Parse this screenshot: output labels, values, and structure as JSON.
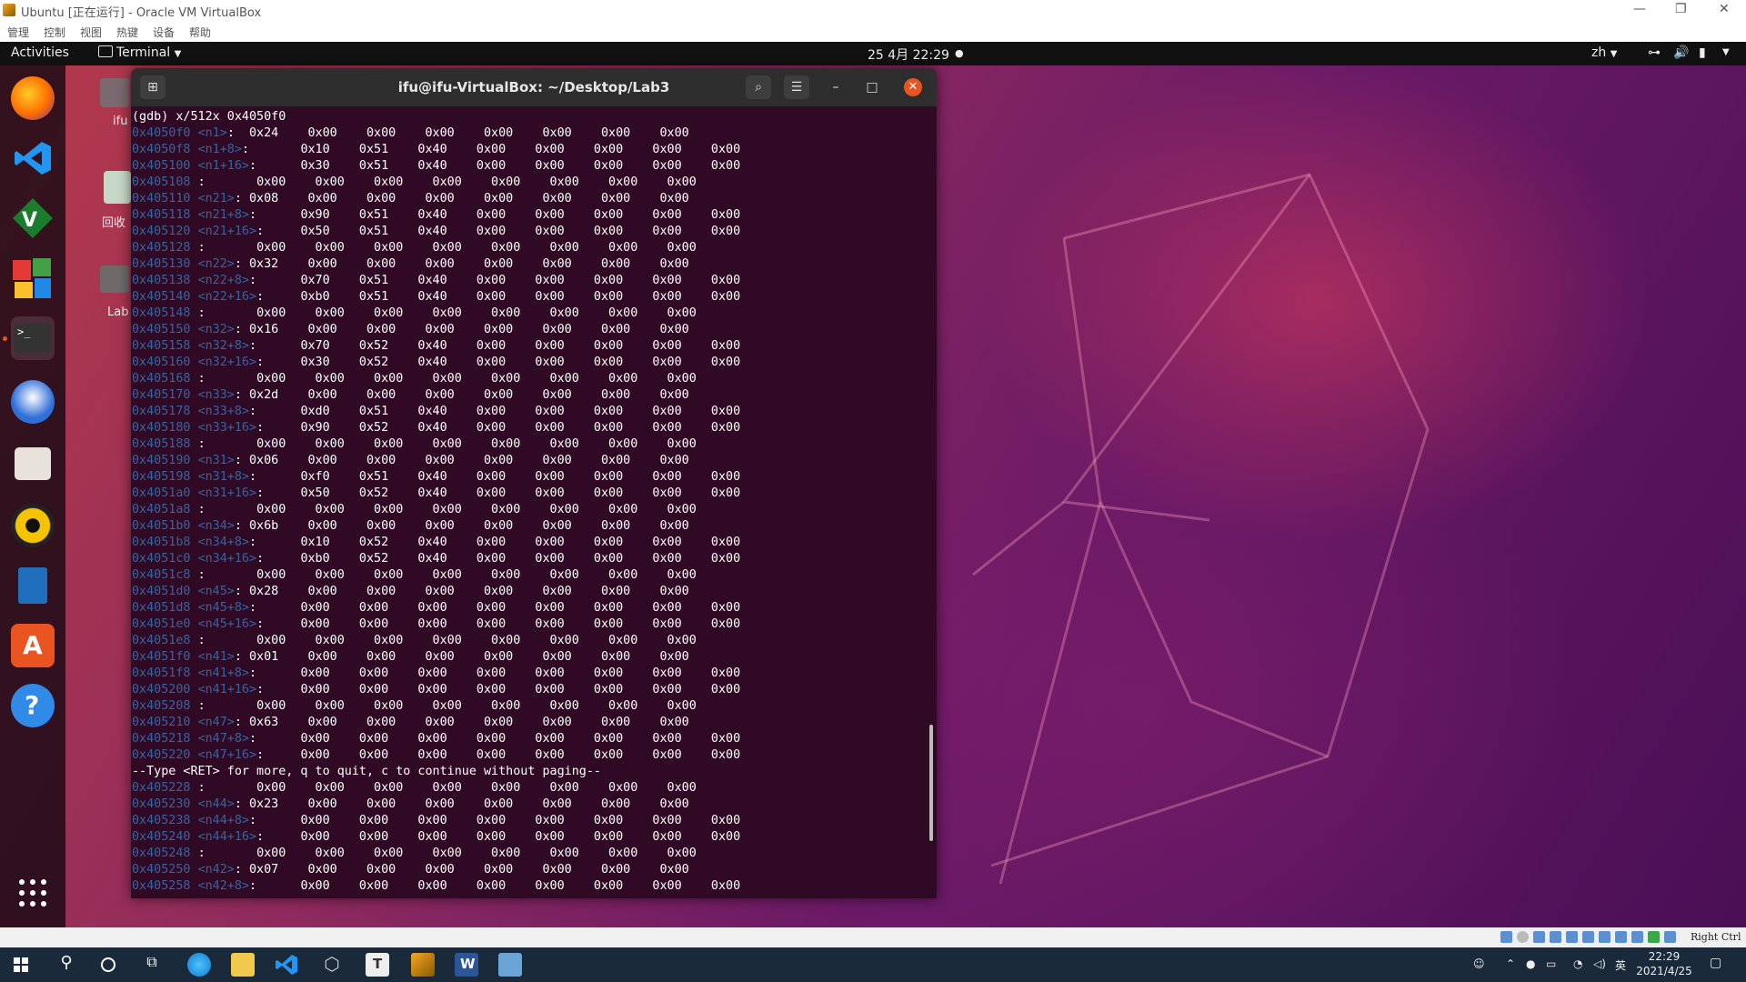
{
  "host": {
    "title": "Ubuntu [正在运行] - Oracle VM VirtualBox",
    "menu": [
      "管理",
      "控制",
      "视图",
      "热键",
      "设备",
      "帮助"
    ]
  },
  "ubuntu_topbar": {
    "activities": "Activities",
    "app_menu": "Terminal",
    "clock": "25 4月  22:29",
    "lang": "zh"
  },
  "desktop": {
    "icons": [
      {
        "label": "ifu"
      },
      {
        "label": "回收"
      },
      {
        "label": "Lab"
      }
    ]
  },
  "terminal": {
    "title": "ifu@ifu-VirtualBox: ~/Desktop/Lab3",
    "command": "(gdb) x/512x 0x4050f0",
    "rows": [
      {
        "addr": "0x4050f0",
        "sym": "<n1>",
        "suffix": ":  ",
        "vals": "0x24    0x00    0x00    0x00    0x00    0x00    0x00    0x00"
      },
      {
        "addr": "0x4050f8",
        "sym": "<n1+8>",
        "suffix": ":       ",
        "vals": "0x10    0x51    0x40    0x00    0x00    0x00    0x00    0x00"
      },
      {
        "addr": "0x405100",
        "sym": "<n1+16>",
        "suffix": ":      ",
        "vals": "0x30    0x51    0x40    0x00    0x00    0x00    0x00    0x00"
      },
      {
        "addr": "0x405108",
        "sym": "",
        "suffix": ":       ",
        "vals": "0x00    0x00    0x00    0x00    0x00    0x00    0x00    0x00"
      },
      {
        "addr": "0x405110",
        "sym": "<n21>",
        "suffix": ": ",
        "vals": "0x08    0x00    0x00    0x00    0x00    0x00    0x00    0x00"
      },
      {
        "addr": "0x405118",
        "sym": "<n21+8>",
        "suffix": ":      ",
        "vals": "0x90    0x51    0x40    0x00    0x00    0x00    0x00    0x00"
      },
      {
        "addr": "0x405120",
        "sym": "<n21+16>",
        "suffix": ":     ",
        "vals": "0x50    0x51    0x40    0x00    0x00    0x00    0x00    0x00"
      },
      {
        "addr": "0x405128",
        "sym": "",
        "suffix": ":       ",
        "vals": "0x00    0x00    0x00    0x00    0x00    0x00    0x00    0x00"
      },
      {
        "addr": "0x405130",
        "sym": "<n22>",
        "suffix": ": ",
        "vals": "0x32    0x00    0x00    0x00    0x00    0x00    0x00    0x00"
      },
      {
        "addr": "0x405138",
        "sym": "<n22+8>",
        "suffix": ":      ",
        "vals": "0x70    0x51    0x40    0x00    0x00    0x00    0x00    0x00"
      },
      {
        "addr": "0x405140",
        "sym": "<n22+16>",
        "suffix": ":     ",
        "vals": "0xb0    0x51    0x40    0x00    0x00    0x00    0x00    0x00"
      },
      {
        "addr": "0x405148",
        "sym": "",
        "suffix": ":       ",
        "vals": "0x00    0x00    0x00    0x00    0x00    0x00    0x00    0x00"
      },
      {
        "addr": "0x405150",
        "sym": "<n32>",
        "suffix": ": ",
        "vals": "0x16    0x00    0x00    0x00    0x00    0x00    0x00    0x00"
      },
      {
        "addr": "0x405158",
        "sym": "<n32+8>",
        "suffix": ":      ",
        "vals": "0x70    0x52    0x40    0x00    0x00    0x00    0x00    0x00"
      },
      {
        "addr": "0x405160",
        "sym": "<n32+16>",
        "suffix": ":     ",
        "vals": "0x30    0x52    0x40    0x00    0x00    0x00    0x00    0x00"
      },
      {
        "addr": "0x405168",
        "sym": "",
        "suffix": ":       ",
        "vals": "0x00    0x00    0x00    0x00    0x00    0x00    0x00    0x00"
      },
      {
        "addr": "0x405170",
        "sym": "<n33>",
        "suffix": ": ",
        "vals": "0x2d    0x00    0x00    0x00    0x00    0x00    0x00    0x00"
      },
      {
        "addr": "0x405178",
        "sym": "<n33+8>",
        "suffix": ":      ",
        "vals": "0xd0    0x51    0x40    0x00    0x00    0x00    0x00    0x00"
      },
      {
        "addr": "0x405180",
        "sym": "<n33+16>",
        "suffix": ":     ",
        "vals": "0x90    0x52    0x40    0x00    0x00    0x00    0x00    0x00"
      },
      {
        "addr": "0x405188",
        "sym": "",
        "suffix": ":       ",
        "vals": "0x00    0x00    0x00    0x00    0x00    0x00    0x00    0x00"
      },
      {
        "addr": "0x405190",
        "sym": "<n31>",
        "suffix": ": ",
        "vals": "0x06    0x00    0x00    0x00    0x00    0x00    0x00    0x00"
      },
      {
        "addr": "0x405198",
        "sym": "<n31+8>",
        "suffix": ":      ",
        "vals": "0xf0    0x51    0x40    0x00    0x00    0x00    0x00    0x00"
      },
      {
        "addr": "0x4051a0",
        "sym": "<n31+16>",
        "suffix": ":     ",
        "vals": "0x50    0x52    0x40    0x00    0x00    0x00    0x00    0x00"
      },
      {
        "addr": "0x4051a8",
        "sym": "",
        "suffix": ":       ",
        "vals": "0x00    0x00    0x00    0x00    0x00    0x00    0x00    0x00"
      },
      {
        "addr": "0x4051b0",
        "sym": "<n34>",
        "suffix": ": ",
        "vals": "0x6b    0x00    0x00    0x00    0x00    0x00    0x00    0x00"
      },
      {
        "addr": "0x4051b8",
        "sym": "<n34+8>",
        "suffix": ":      ",
        "vals": "0x10    0x52    0x40    0x00    0x00    0x00    0x00    0x00"
      },
      {
        "addr": "0x4051c0",
        "sym": "<n34+16>",
        "suffix": ":     ",
        "vals": "0xb0    0x52    0x40    0x00    0x00    0x00    0x00    0x00"
      },
      {
        "addr": "0x4051c8",
        "sym": "",
        "suffix": ":       ",
        "vals": "0x00    0x00    0x00    0x00    0x00    0x00    0x00    0x00"
      },
      {
        "addr": "0x4051d0",
        "sym": "<n45>",
        "suffix": ": ",
        "vals": "0x28    0x00    0x00    0x00    0x00    0x00    0x00    0x00"
      },
      {
        "addr": "0x4051d8",
        "sym": "<n45+8>",
        "suffix": ":      ",
        "vals": "0x00    0x00    0x00    0x00    0x00    0x00    0x00    0x00"
      },
      {
        "addr": "0x4051e0",
        "sym": "<n45+16>",
        "suffix": ":     ",
        "vals": "0x00    0x00    0x00    0x00    0x00    0x00    0x00    0x00"
      },
      {
        "addr": "0x4051e8",
        "sym": "",
        "suffix": ":       ",
        "vals": "0x00    0x00    0x00    0x00    0x00    0x00    0x00    0x00"
      },
      {
        "addr": "0x4051f0",
        "sym": "<n41>",
        "suffix": ": ",
        "vals": "0x01    0x00    0x00    0x00    0x00    0x00    0x00    0x00"
      },
      {
        "addr": "0x4051f8",
        "sym": "<n41+8>",
        "suffix": ":      ",
        "vals": "0x00    0x00    0x00    0x00    0x00    0x00    0x00    0x00"
      },
      {
        "addr": "0x405200",
        "sym": "<n41+16>",
        "suffix": ":     ",
        "vals": "0x00    0x00    0x00    0x00    0x00    0x00    0x00    0x00"
      },
      {
        "addr": "0x405208",
        "sym": "",
        "suffix": ":       ",
        "vals": "0x00    0x00    0x00    0x00    0x00    0x00    0x00    0x00"
      },
      {
        "addr": "0x405210",
        "sym": "<n47>",
        "suffix": ": ",
        "vals": "0x63    0x00    0x00    0x00    0x00    0x00    0x00    0x00"
      },
      {
        "addr": "0x405218",
        "sym": "<n47+8>",
        "suffix": ":      ",
        "vals": "0x00    0x00    0x00    0x00    0x00    0x00    0x00    0x00"
      },
      {
        "addr": "0x405220",
        "sym": "<n47+16>",
        "suffix": ":     ",
        "vals": "0x00    0x00    0x00    0x00    0x00    0x00    0x00    0x00"
      },
      {
        "addr": "",
        "sym": "",
        "suffix": "",
        "vals": "--Type <RET> for more, q to quit, c to continue without paging--"
      },
      {
        "addr": "0x405228",
        "sym": "",
        "suffix": ":       ",
        "vals": "0x00    0x00    0x00    0x00    0x00    0x00    0x00    0x00"
      },
      {
        "addr": "0x405230",
        "sym": "<n44>",
        "suffix": ": ",
        "vals": "0x23    0x00    0x00    0x00    0x00    0x00    0x00    0x00"
      },
      {
        "addr": "0x405238",
        "sym": "<n44+8>",
        "suffix": ":      ",
        "vals": "0x00    0x00    0x00    0x00    0x00    0x00    0x00    0x00"
      },
      {
        "addr": "0x405240",
        "sym": "<n44+16>",
        "suffix": ":     ",
        "vals": "0x00    0x00    0x00    0x00    0x00    0x00    0x00    0x00"
      },
      {
        "addr": "0x405248",
        "sym": "",
        "suffix": ":       ",
        "vals": "0x00    0x00    0x00    0x00    0x00    0x00    0x00    0x00"
      },
      {
        "addr": "0x405250",
        "sym": "<n42>",
        "suffix": ": ",
        "vals": "0x07    0x00    0x00    0x00    0x00    0x00    0x00    0x00"
      },
      {
        "addr": "0x405258",
        "sym": "<n42+8>",
        "suffix": ":      ",
        "vals": "0x00    0x00    0x00    0x00    0x00    0x00    0x00    0x00"
      }
    ]
  },
  "vb_status": {
    "hostkey": "Right Ctrl"
  },
  "taskbar": {
    "ime": "英",
    "time": "22:29",
    "date": "2021/4/25"
  },
  "colors": {
    "accent": "#e95420",
    "term_bg": "#300a24",
    "addr": "#3465a4"
  }
}
